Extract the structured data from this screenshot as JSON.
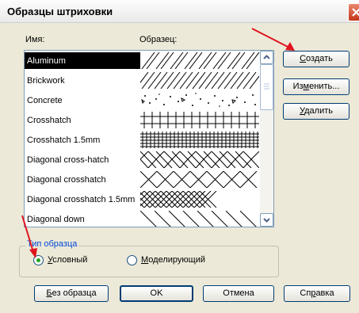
{
  "dialog": {
    "title": "Образцы штриховки"
  },
  "list": {
    "col_name": "Имя:",
    "col_sample": "Образец:",
    "items": [
      {
        "label": "Aluminum",
        "selected": true
      },
      {
        "label": "Brickwork"
      },
      {
        "label": "Concrete"
      },
      {
        "label": "Crosshatch"
      },
      {
        "label": "Crosshatch 1.5mm"
      },
      {
        "label": "Diagonal cross-hatch"
      },
      {
        "label": "Diagonal crosshatch"
      },
      {
        "label": "Diagonal crosshatch 1.5mm"
      },
      {
        "label": "Diagonal down"
      }
    ]
  },
  "side_buttons": {
    "create_pre": "",
    "create_u": "С",
    "create_post": "оздать",
    "edit_pre": "Из",
    "edit_u": "м",
    "edit_post": "енить...",
    "delete_pre": "",
    "delete_u": "У",
    "delete_post": "далить"
  },
  "pattern_type": {
    "group_label": "Тип образца",
    "option1_pre": "",
    "option1_u": "У",
    "option1_post": "словный",
    "option2_pre": "",
    "option2_u": "М",
    "option2_post": "оделирующий",
    "selected": "option1"
  },
  "bottom_buttons": {
    "no_pattern_pre": "",
    "no_pattern_u": "Б",
    "no_pattern_post": "ез образца",
    "ok": "OK",
    "cancel": "Отмена",
    "help_pre": "Сп",
    "help_u": "р",
    "help_post": "авка"
  },
  "colors": {
    "annotation_arrow": "#e0141e",
    "radio_dot": "#21a121",
    "group_title": "#0046d5"
  }
}
